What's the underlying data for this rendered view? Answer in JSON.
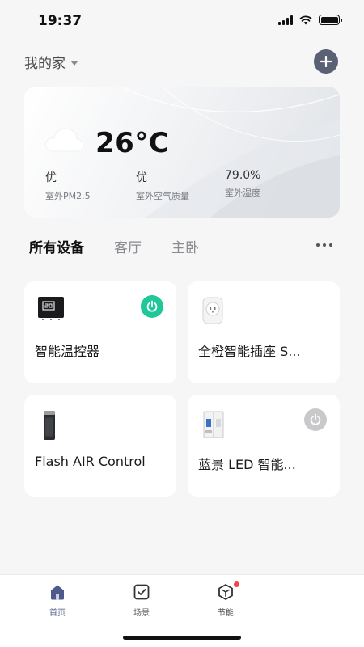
{
  "status_bar": {
    "time": "19:37",
    "icons": [
      "signal-icon",
      "wifi-icon",
      "battery-icon"
    ]
  },
  "header": {
    "home_name": "我的家",
    "dropdown_icon": "caret-down-icon",
    "add_icon": "plus-icon"
  },
  "weather": {
    "icon": "cloud-icon",
    "temperature": "26°C",
    "metrics": [
      {
        "value": "优",
        "label": "室外PM2.5"
      },
      {
        "value": "优",
        "label": "室外空气质量"
      },
      {
        "value": "79.0%",
        "label": "室外湿度"
      }
    ]
  },
  "tabs": [
    {
      "label": "所有设备",
      "active": true
    },
    {
      "label": "客厅",
      "active": false
    },
    {
      "label": "主卧",
      "active": false
    }
  ],
  "more_icon": "more-horizontal-icon",
  "devices": [
    {
      "name": "智能温控器",
      "icon": "thermostat-icon",
      "power": "on"
    },
    {
      "name": "全橙智能插座 S...",
      "icon": "smart-plug-icon",
      "power": null
    },
    {
      "name": "Flash AIR Control",
      "icon": "air-purifier-icon",
      "power": null
    },
    {
      "name": "蓝景 LED 智能...",
      "icon": "circuit-breaker-icon",
      "power": "off"
    }
  ],
  "bottom_nav": [
    {
      "label": "首页",
      "icon": "home-icon",
      "active": true
    },
    {
      "label": "场景",
      "icon": "scene-check-icon",
      "active": false
    },
    {
      "label": "节能",
      "icon": "energy-cube-icon",
      "active": false,
      "badge": true
    }
  ],
  "colors": {
    "power_on": "#1fc79a",
    "power_off": "#c9c9cc",
    "accent": "#4d5a8a",
    "add_button": "#5b6175",
    "badge": "#f04848"
  }
}
